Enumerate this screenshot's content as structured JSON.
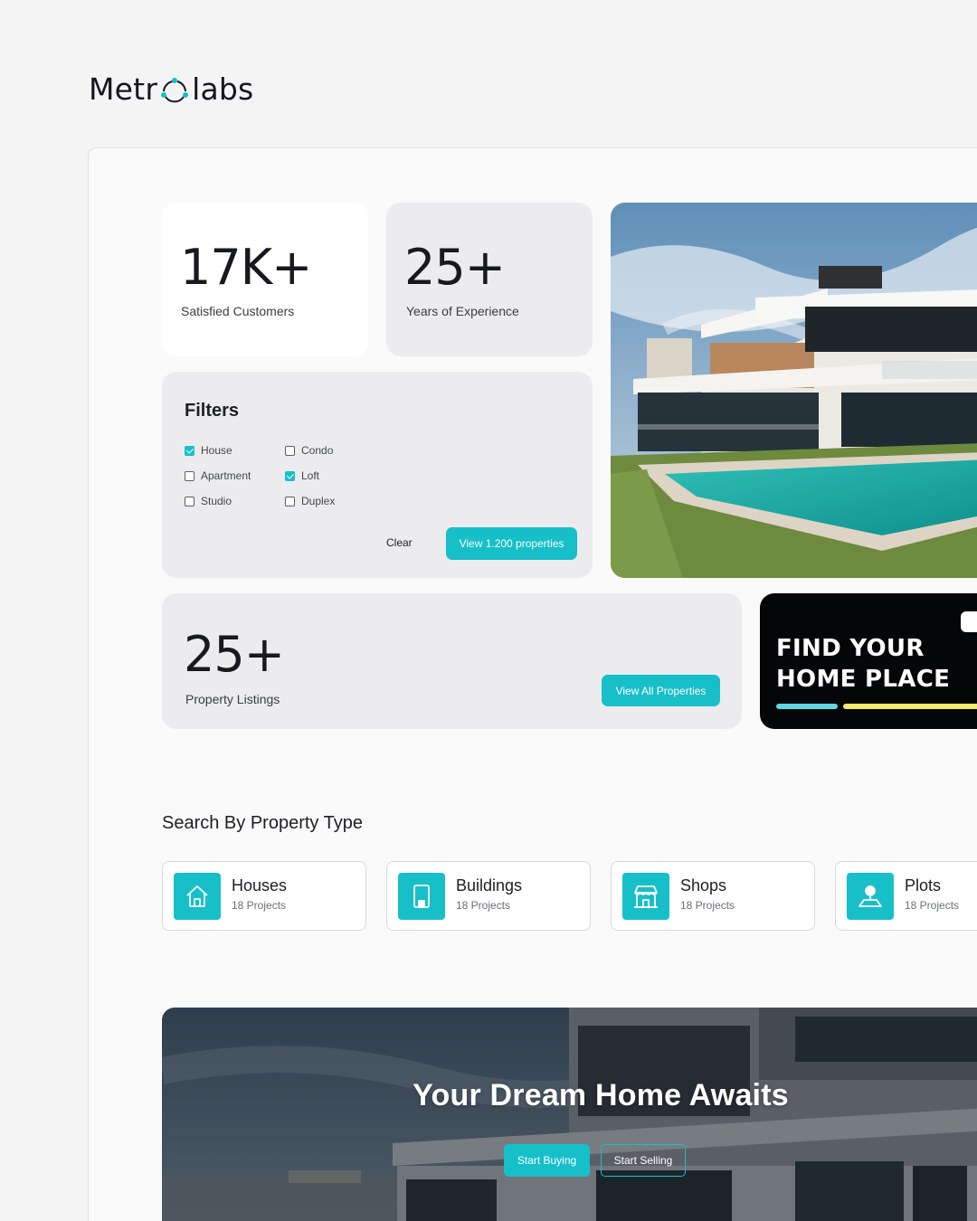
{
  "brand": {
    "left": "Metr",
    "right": "labs",
    "accent": "#17bfc9"
  },
  "stats": {
    "customers": {
      "value": "17K+",
      "label": "Satisfied Customers"
    },
    "experience": {
      "value": "25+",
      "label": "Years of Experience"
    },
    "listings": {
      "value": "25+",
      "label": "Property Listings",
      "button": "View All Properties"
    }
  },
  "filters": {
    "title": "Filters",
    "options": [
      {
        "label": "House",
        "checked": true
      },
      {
        "label": "Apartment",
        "checked": false
      },
      {
        "label": "Studio",
        "checked": false
      },
      {
        "label": "Condo",
        "checked": false
      },
      {
        "label": "Loft",
        "checked": true
      },
      {
        "label": "Duplex",
        "checked": false
      }
    ],
    "clear_label": "Clear",
    "apply_label": "View 1.200 properties"
  },
  "promo": {
    "line1": "FIND YOUR",
    "line2": "HOME PLACE"
  },
  "property_types": {
    "title": "Search By Property Type",
    "items": [
      {
        "name": "Houses",
        "count": "18 Projects",
        "icon": "house-icon"
      },
      {
        "name": "Buildings",
        "count": "18 Projects",
        "icon": "building-icon"
      },
      {
        "name": "Shops",
        "count": "18 Projects",
        "icon": "shop-icon"
      },
      {
        "name": "Plots",
        "count": "18 Projects",
        "icon": "plot-pin-icon"
      }
    ]
  },
  "hero": {
    "title": "Your Dream Home Awaits",
    "buy_label": "Start Buying",
    "sell_label": "Start Selling"
  }
}
